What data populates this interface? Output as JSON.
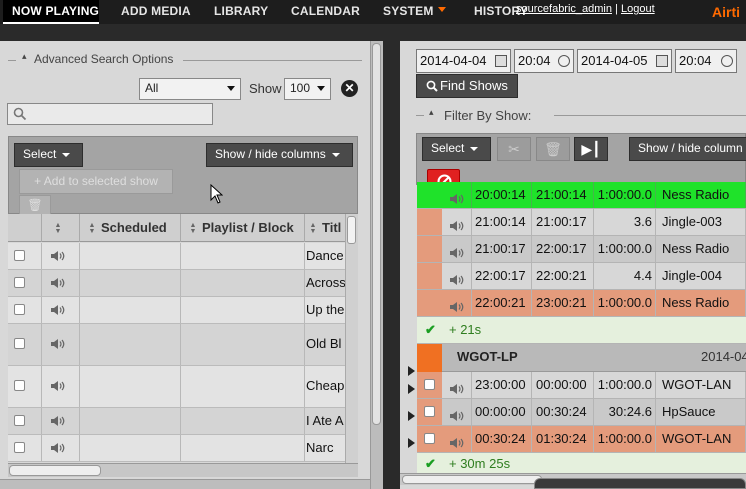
{
  "nav": {
    "items": [
      "NOW PLAYING",
      "ADD MEDIA",
      "LIBRARY",
      "CALENDAR",
      "SYSTEM",
      "HISTORY"
    ],
    "user_link": "sourcefabric_admin",
    "separator": "|",
    "logout": "Logout",
    "brand": "Airti"
  },
  "left": {
    "advanced_search": "Advanced Search Options",
    "type_select": "All",
    "show_label": "Show",
    "show_count": "100",
    "search_placeholder": "",
    "select_button": "Select",
    "show_hide_columns": "Show / hide columns",
    "add_to_selected": "Add to selected show",
    "columns": {
      "scheduled": "Scheduled",
      "playlist_block": "Playlist / Block",
      "title": "Titl"
    },
    "rows": [
      {
        "title": "Dance"
      },
      {
        "title": "Across"
      },
      {
        "title": "Up the"
      },
      {
        "title": "Old Bl"
      },
      {
        "title": "Cheap"
      },
      {
        "title": "I Ate A"
      },
      {
        "title": "Narc"
      }
    ]
  },
  "right": {
    "start_date": "2014-04-04",
    "start_time": "20:04",
    "end_date": "2014-04-05",
    "end_time": "20:04",
    "find_shows": "Find Shows",
    "filter_by_show": "Filter By Show:",
    "select_button": "Select",
    "show_hide_columns": "Show / hide column",
    "rows_a": [
      {
        "start": "20:00:14",
        "end": "21:00:14",
        "length": "1:00:00.0",
        "title": "Ness Radio",
        "style": "green"
      },
      {
        "start": "21:00:14",
        "end": "21:00:17",
        "length": "3.6",
        "title": "Jingle-003",
        "style": "grey"
      },
      {
        "start": "21:00:17",
        "end": "22:00:17",
        "length": "1:00:00.0",
        "title": "Ness Radio",
        "style": "greyb"
      },
      {
        "start": "22:00:17",
        "end": "22:00:21",
        "length": "4.4",
        "title": "Jingle-004",
        "style": "grey"
      },
      {
        "start": "22:00:21",
        "end": "23:00:21",
        "length": "1:00:00.0",
        "title": "Ness Radio",
        "style": "orange"
      }
    ],
    "footer_a": "+ 21s",
    "show_name": "WGOT-LP",
    "show_date": "2014-04",
    "rows_b": [
      {
        "start": "23:00:00",
        "end": "00:00:00",
        "length": "1:00:00.0",
        "title": "WGOT-LAN",
        "style": "grey"
      },
      {
        "start": "00:00:00",
        "end": "00:30:24",
        "length": "30:24.6",
        "title": "HpSauce",
        "style": "greyb"
      },
      {
        "start": "00:30:24",
        "end": "01:30:24",
        "length": "1:00:00.0",
        "title": "WGOT-LAN",
        "style": "orange"
      }
    ],
    "footer_b": "+ 30m 25s"
  },
  "colors": {
    "accent": "#ff6a00",
    "now_playing": "#1fe22a",
    "overbooked": "#e49b7c",
    "danger": "#e02121",
    "show_bar": "#f07022"
  }
}
